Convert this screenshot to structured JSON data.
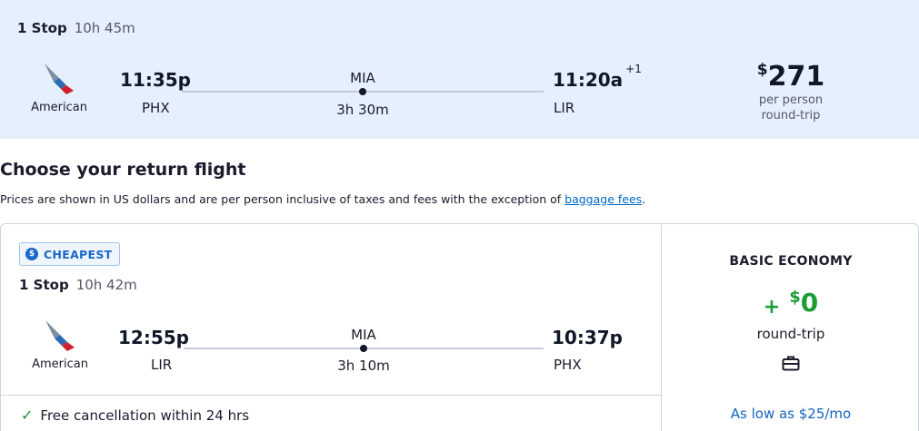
{
  "outbound": {
    "stops": "1 Stop",
    "duration": "10h 45m",
    "airline": "American",
    "depart_time": "11:35p",
    "depart_code": "PHX",
    "via": "MIA",
    "layover": "3h 30m",
    "arrive_time": "11:20a",
    "arrive_day_offset": "+1",
    "arrive_code": "LIR",
    "price_currency": "$",
    "price": "271",
    "price_note_1": "per person",
    "price_note_2": "round-trip"
  },
  "section": {
    "title": "Choose your return flight",
    "disclaimer": "Prices are shown in US dollars and are per person inclusive of taxes and fees with the exception of ",
    "link": "baggage fees",
    "period": "."
  },
  "return_option": {
    "badge": "CHEAPEST",
    "badge_icon": "dollar-icon",
    "stops": "1 Stop",
    "duration": "10h 42m",
    "airline": "American",
    "depart_time": "12:55p",
    "depart_code": "LIR",
    "via": "MIA",
    "layover": "3h 10m",
    "arrive_time": "10:37p",
    "arrive_code": "PHX",
    "free_cancel": "Free cancellation within 24 hrs",
    "fare_name": "BASIC ECONOMY",
    "fare_plus": "+",
    "fare_currency": "$",
    "fare_price": "0",
    "fare_note": "round-trip",
    "fare_icon": "briefcase-icon",
    "monthly": "As low as $25/mo"
  },
  "colors": {
    "banner_bg": "#e5f0fc",
    "accent_blue": "#1a68c8",
    "link_blue": "#0067c5",
    "fare_green": "#1a9d36"
  }
}
